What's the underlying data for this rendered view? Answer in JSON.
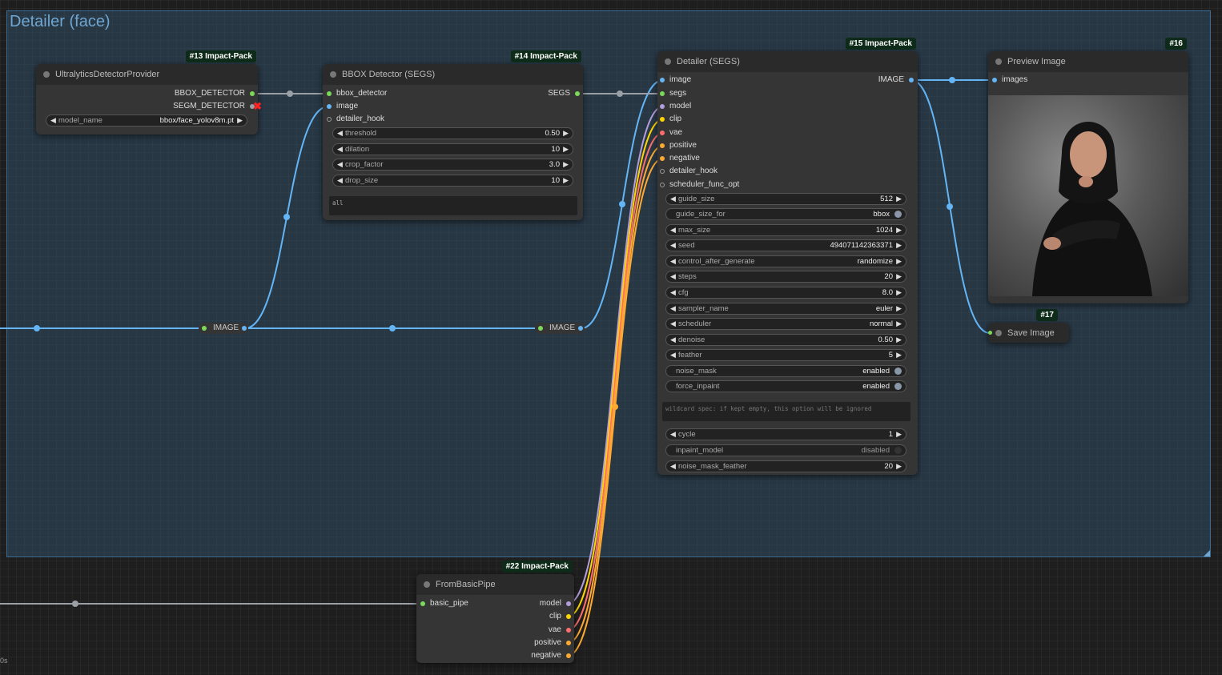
{
  "group": {
    "title": "Detailer (face)"
  },
  "colors": {
    "image": "#64b5f6",
    "model": "#b39ddb",
    "clip": "#ffd500",
    "vae": "#ff6e6e",
    "conditioning": "#ffa931",
    "generic": "#9aa0a6",
    "bbox": "#7cd85a"
  },
  "nodes": {
    "n13": {
      "badge": "#13 Impact-Pack",
      "title": "UltralyticsDetectorProvider",
      "out_bbox": "BBOX_DETECTOR",
      "out_segm": "SEGM_DETECTOR",
      "model_name_label": "model_name",
      "model_name_value": "bbox/face_yolov8m.pt"
    },
    "n14": {
      "badge": "#14 Impact-Pack",
      "title": "BBOX Detector (SEGS)",
      "in_bbox": "bbox_detector",
      "in_image": "image",
      "in_hook": "detailer_hook",
      "out_segs": "SEGS",
      "widgets": [
        {
          "label": "threshold",
          "value": "0.50"
        },
        {
          "label": "dilation",
          "value": "10"
        },
        {
          "label": "crop_factor",
          "value": "3.0"
        },
        {
          "label": "drop_size",
          "value": "10"
        }
      ],
      "labels_text": "all"
    },
    "n15": {
      "badge": "#15 Impact-Pack",
      "title": "Detailer (SEGS)",
      "inputs": [
        "image",
        "segs",
        "model",
        "clip",
        "vae",
        "positive",
        "negative",
        "detailer_hook",
        "scheduler_func_opt"
      ],
      "out_image": "IMAGE",
      "widgets": [
        {
          "label": "guide_size",
          "value": "512"
        },
        {
          "label": "guide_size_for",
          "value": "bbox"
        },
        {
          "label": "max_size",
          "value": "1024"
        },
        {
          "label": "seed",
          "value": "494071142363371"
        },
        {
          "label": "control_after_generate",
          "value": "randomize"
        },
        {
          "label": "steps",
          "value": "20"
        },
        {
          "label": "cfg",
          "value": "8.0"
        },
        {
          "label": "sampler_name",
          "value": "euler"
        },
        {
          "label": "scheduler",
          "value": "normal"
        },
        {
          "label": "denoise",
          "value": "0.50"
        },
        {
          "label": "feather",
          "value": "5"
        },
        {
          "label": "noise_mask",
          "value": "enabled"
        },
        {
          "label": "force_inpaint",
          "value": "enabled"
        }
      ],
      "wildcard_placeholder": "wildcard spec: if kept empty, this option will be ignored",
      "widgets2": [
        {
          "label": "cycle",
          "value": "1"
        },
        {
          "label": "inpaint_model",
          "value": "disabled"
        },
        {
          "label": "noise_mask_feather",
          "value": "20"
        }
      ]
    },
    "n16": {
      "badge": "#16",
      "title": "Preview Image",
      "in_images": "images"
    },
    "n17": {
      "badge": "#17",
      "title": "Save Image"
    },
    "n22": {
      "badge": "#22 Impact-Pack",
      "title": "FromBasicPipe",
      "in_pipe": "basic_pipe",
      "outputs": [
        "model",
        "clip",
        "vae",
        "positive",
        "negative"
      ]
    }
  },
  "reroutes": {
    "r1": "IMAGE",
    "r2": "IMAGE"
  },
  "status": {
    "text": "0s"
  }
}
